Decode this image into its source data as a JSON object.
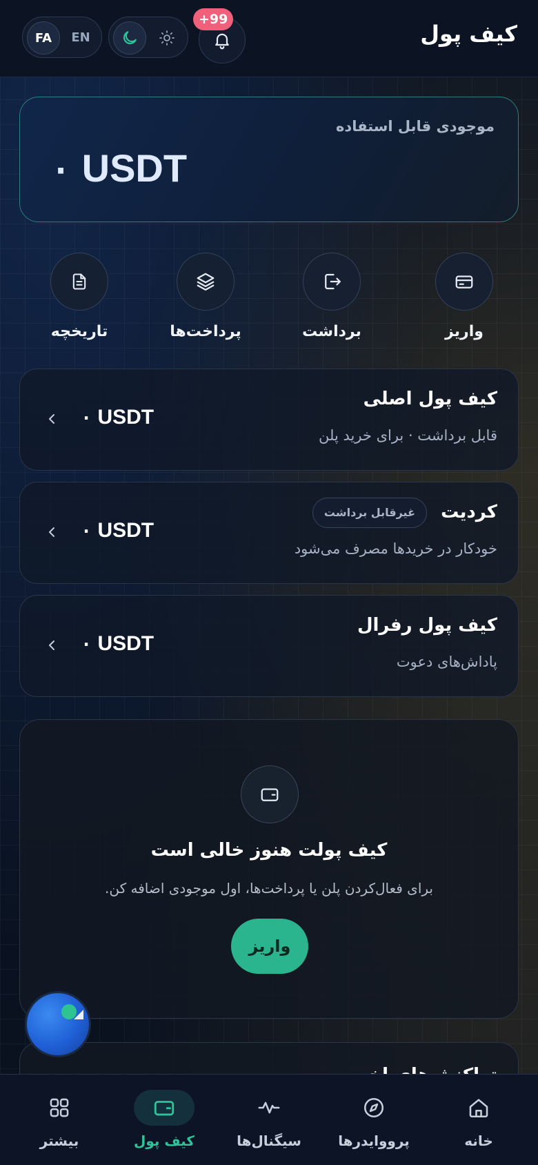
{
  "header": {
    "title": "کیف پول",
    "lang": {
      "active": "FA",
      "inactive": "EN"
    },
    "theme": {
      "active_icon": "moon-icon",
      "inactive_icon": "sun-icon"
    },
    "notifications_badge": "+99"
  },
  "balance": {
    "label": "موجودی قابل استفاده",
    "amount": "۰ USDT"
  },
  "actions": [
    {
      "label": "واریز",
      "icon": "card-icon"
    },
    {
      "label": "برداشت",
      "icon": "logout-icon"
    },
    {
      "label": "پرداخت‌ها",
      "icon": "layers-icon"
    },
    {
      "label": "تاریخچه",
      "icon": "document-icon"
    }
  ],
  "wallets": [
    {
      "title": "کیف پول اصلی",
      "subtitle": "قابل برداشت · برای خرید پلن",
      "amount": "۰ USDT"
    },
    {
      "title": "کردیت",
      "tag": "غیرقابل برداشت",
      "subtitle": "خودکار در خریدها مصرف می‌شود",
      "amount": "۰ USDT"
    },
    {
      "title": "کیف پول رفرال",
      "subtitle": "پاداش‌های دعوت",
      "amount": "۰ USDT"
    }
  ],
  "empty_state": {
    "title": "کیف پولت هنوز خالی است",
    "description": "برای فعال‌کردن پلن یا پرداخت‌ها، اول موجودی اضافه کن.",
    "button": "واریز"
  },
  "recent": {
    "title": "تراکنش‌های اخیر"
  },
  "nav": [
    {
      "label": "خانه",
      "icon": "home-icon",
      "active": false
    },
    {
      "label": "پرووایدرها",
      "icon": "compass-icon",
      "active": false
    },
    {
      "label": "سیگنال‌ها",
      "icon": "pulse-icon",
      "active": false
    },
    {
      "label": "کیف پول",
      "icon": "wallet-icon",
      "active": true
    },
    {
      "label": "بیشتر",
      "icon": "grid-icon",
      "active": false
    }
  ],
  "colors": {
    "accent": "#2bb58f",
    "badge": "#f0607a",
    "background": "#0a111e"
  }
}
